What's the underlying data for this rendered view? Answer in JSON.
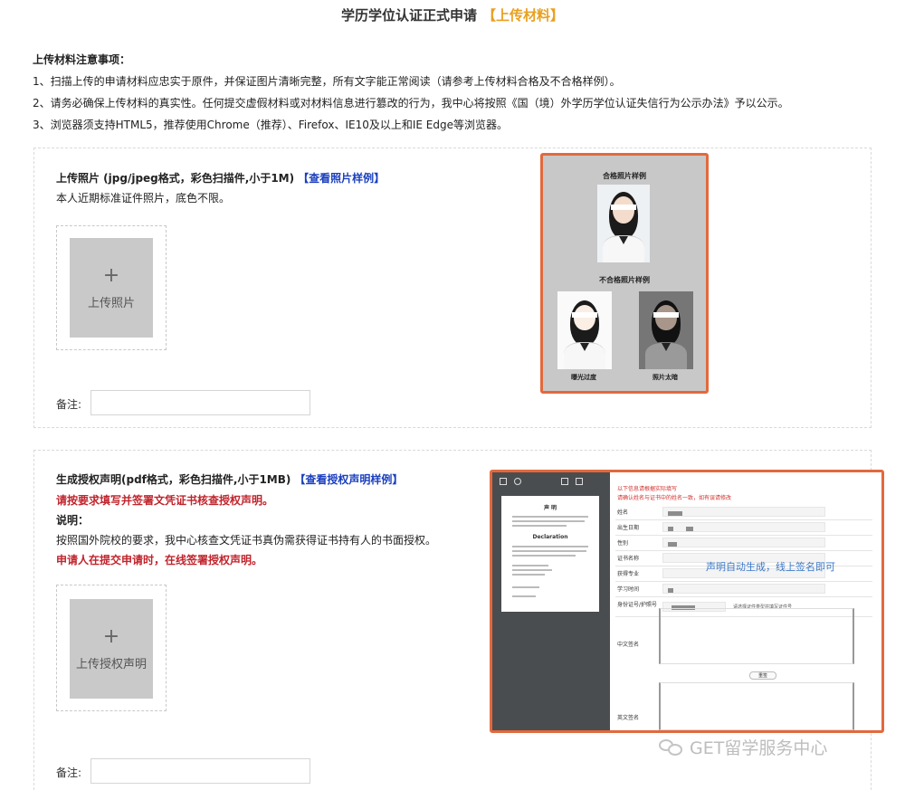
{
  "header": {
    "title": "学历学位认证正式申请",
    "step": "【上传材料】"
  },
  "notes": {
    "title": "上传材料注意事项：",
    "items": [
      "1、扫描上传的申请材料应忠实于原件，并保证图片清晰完整，所有文字能正常阅读（请参考上传材料合格及不合格样例）。",
      "2、请务必确保上传材料的真实性。任何提交虚假材料或对材料信息进行篡改的行为，我中心将按照《国（境）外学历学位认证失信行为公示办法》予以公示。",
      "3、浏览器须支持HTML5，推荐使用Chrome（推荐）、Firefox、IE10及以上和IE Edge等浏览器。"
    ]
  },
  "photo_section": {
    "title": "上传照片 (jpg/jpeg格式，彩色扫描件,小于1M)",
    "sample_link": "【查看照片样例】",
    "desc": "本人近期标准证件照片，底色不限。",
    "upload_plus": "+",
    "upload_label": "上传照片",
    "remark_label": "备注:",
    "remark_value": "",
    "sample": {
      "qualified_caption": "合格照片样例",
      "unqualified_caption": "不合格照片样例",
      "overexposed_caption": "曝光过度",
      "too_dark_caption": "照片太暗"
    }
  },
  "auth_section": {
    "title": "生成授权声明(pdf格式，彩色扫描件,小于1MB)",
    "sample_link": "【查看授权声明样例】",
    "red_note": "请按要求填写并签署文凭证书核查授权声明。",
    "explain_label": "说明：",
    "explain_text": "按照国外院校的要求，我中心核查文凭证书真伪需获得证书持有人的书面授权。",
    "red_note2": "申请人在提交申请时，在线签署授权声明。",
    "upload_plus": "+",
    "upload_label": "上传授权声明",
    "remark_label": "备注:",
    "remark_value": "",
    "sample": {
      "doc_title": "声 明",
      "doc_subtitle": "Declaration",
      "red_line1": "以下信息请根据实际填写",
      "red_line2": "请确认姓名与证书中的姓名一致，如有误请修改",
      "fields": [
        "姓名",
        "出生日期",
        "性别",
        "证书名称",
        "获得专业",
        "学习时间",
        "身份证号/护照号"
      ],
      "id_hint": "请选择证件类型并填写证件号",
      "chinese_sign": "中文签名",
      "english_sign": "英文签名",
      "clear_button": "重签",
      "auto_note": "声明自动生成，线上签名即可"
    }
  },
  "watermark": {
    "text": "GET留学服务中心"
  }
}
